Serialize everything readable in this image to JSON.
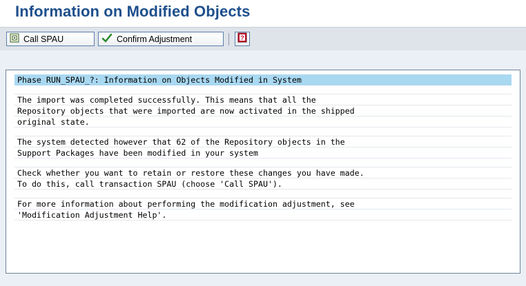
{
  "page": {
    "title": "Information on Modified Objects"
  },
  "toolbar": {
    "call_spau_label": "Call SPAU",
    "confirm_label": "Confirm Adjustment",
    "help_icon": "help-book-icon"
  },
  "message": {
    "header": "Phase RUN_SPAU_?: Information on Objects Modified in System",
    "lines": [
      "The import was completed successfully. This means that all the",
      "Repository objects that were imported are now activated in the shipped",
      "original state.",
      "The system detected however that 62 of the Repository objects in the",
      "Support Packages have been modified in your system",
      "Check whether you want to retain or restore these changes you have made.",
      "To do this, call transaction SPAU (choose 'Call SPAU').",
      "For more information about performing the modification adjustment, see",
      "'Modification Adjustment Help'."
    ]
  },
  "colors": {
    "title": "#1e4f8c",
    "toolbar_bg": "#dfe4ea",
    "content_bg": "#eaf0f6",
    "header_highlight": "#a9d8f1"
  }
}
